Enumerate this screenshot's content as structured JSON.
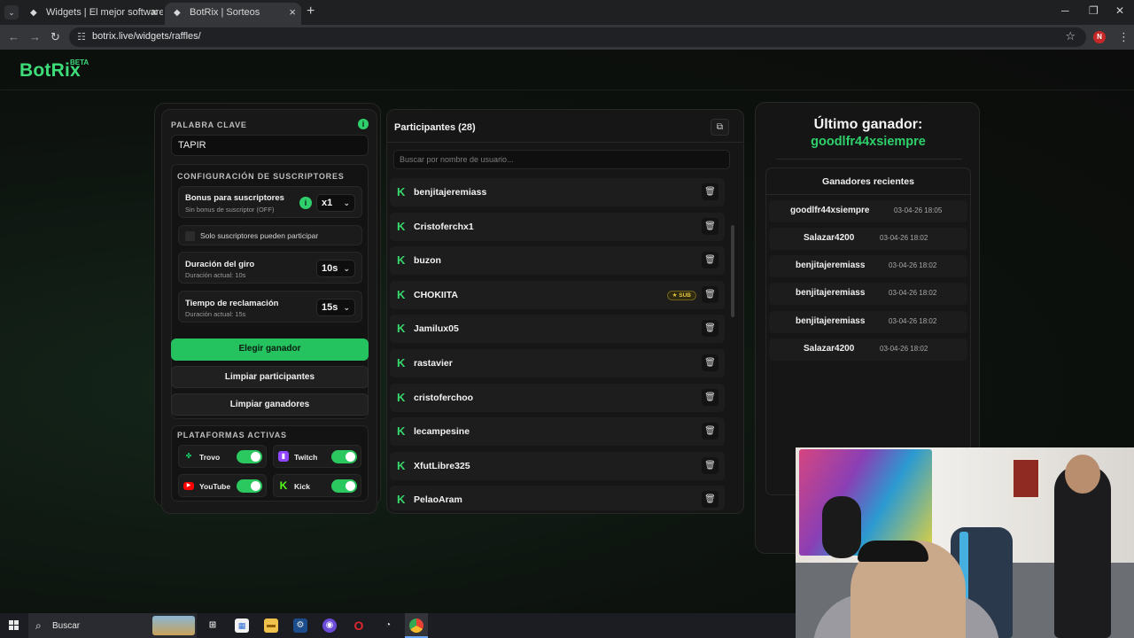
{
  "browser": {
    "tabs": [
      {
        "title": "Widgets | El mejor software para",
        "active": false
      },
      {
        "title": "BotRix | Sorteos",
        "active": true
      }
    ],
    "url": "botrix.live/widgets/raffles/",
    "profile_initial": "N"
  },
  "site": {
    "logo": "BotRix",
    "badge": "BETA"
  },
  "left": {
    "keyword_label": "PALABRA CLAVE",
    "keyword_value": "TAPIR",
    "subs_config_label": "CONFIGURACIÓN DE SUSCRIPTORES",
    "bonus": {
      "title": "Bonus para suscriptores",
      "subtitle": "Sin bonus de suscriptor (OFF)",
      "value": "x1"
    },
    "subs_only_label": "Solo suscriptores pueden participar",
    "spin": {
      "title": "Duración del giro",
      "subtitle": "Duración actual: 10s",
      "value": "10s"
    },
    "claim": {
      "title": "Tiempo de reclamación",
      "subtitle": "Duración actual: 15s",
      "value": "15s"
    },
    "buttons": {
      "pick": "Elegir ganador",
      "clear_participants": "Limpiar participantes",
      "clear_winners": "Limpiar ganadores"
    },
    "platforms_label": "PLATAFORMAS ACTIVAS",
    "platforms": [
      {
        "name": "Trovo",
        "enabled": true,
        "color": "#19d66b"
      },
      {
        "name": "Twitch",
        "enabled": true,
        "color": "#9146ff"
      },
      {
        "name": "YouTube",
        "enabled": true,
        "color": "#ff0000"
      },
      {
        "name": "Kick",
        "enabled": true,
        "color": "#53fc18"
      }
    ]
  },
  "participants": {
    "title": "Participantes (28)",
    "search_placeholder": "Buscar por nombre de usuario...",
    "sub_badge": "★ SUB",
    "list": [
      "benjitajeremiass",
      "Cristoferchx1",
      "buzon",
      "CHOKIITA",
      "Jamilux05",
      "rastavier",
      "cristoferchoo",
      "lecampesine",
      "XfutLibre325",
      "PelaoAram"
    ]
  },
  "winners": {
    "last_title": "Último ganador:",
    "last_name": "goodlfr44xsiempre",
    "recent_title": "Ganadores recientes",
    "recent": [
      {
        "name": "goodlfr44xsiempre",
        "time": "03-04-26 18:05"
      },
      {
        "name": "Salazar4200",
        "time": "03-04-26 18:02"
      },
      {
        "name": "benjitajeremiass",
        "time": "03-04-26 18:02"
      },
      {
        "name": "benjitajeremiass",
        "time": "03-04-26 18:02"
      },
      {
        "name": "benjitajeremiass",
        "time": "03-04-26 18:02"
      },
      {
        "name": "Salazar4200",
        "time": "03-04-26 18:02"
      }
    ]
  },
  "taskbar": {
    "search": "Buscar"
  },
  "colors": {
    "accent": "#2fd06c",
    "button": "#25c35f",
    "background": "#0c0e0c"
  }
}
